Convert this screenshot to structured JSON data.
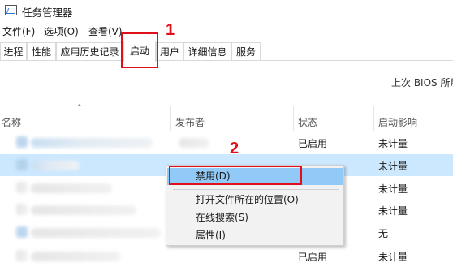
{
  "window": {
    "title": "任务管理器"
  },
  "menu": [
    "文件(F)",
    "选项(O)",
    "查看(V)"
  ],
  "tabs": [
    "进程",
    "性能",
    "应用历史记录",
    "启动",
    "用户",
    "详细信息",
    "服务"
  ],
  "active_tab": "启动",
  "bios_label": "上次 BIOS 所用",
  "columns": {
    "name": "名称",
    "publisher": "发布者",
    "status": "状态",
    "impact": "启动影响"
  },
  "rows": [
    {
      "status": "已启用",
      "impact": "未计量"
    },
    {
      "status": "",
      "impact": "未计量"
    },
    {
      "status": "",
      "impact": "未计量"
    },
    {
      "status": "",
      "impact": "未计量"
    },
    {
      "status": "",
      "impact": "无"
    },
    {
      "status": "已启用",
      "impact": "未计量"
    }
  ],
  "context_menu": {
    "items": [
      "禁用(D)",
      "打开文件所在的位置(O)",
      "在线搜索(S)",
      "属性(I)"
    ],
    "highlighted": "禁用(D)"
  },
  "annotations": [
    "1",
    "2"
  ],
  "colors": {
    "annotation": "#e0101a",
    "selection": "#cce8ff",
    "menu_highlight": "#91c9f7"
  }
}
